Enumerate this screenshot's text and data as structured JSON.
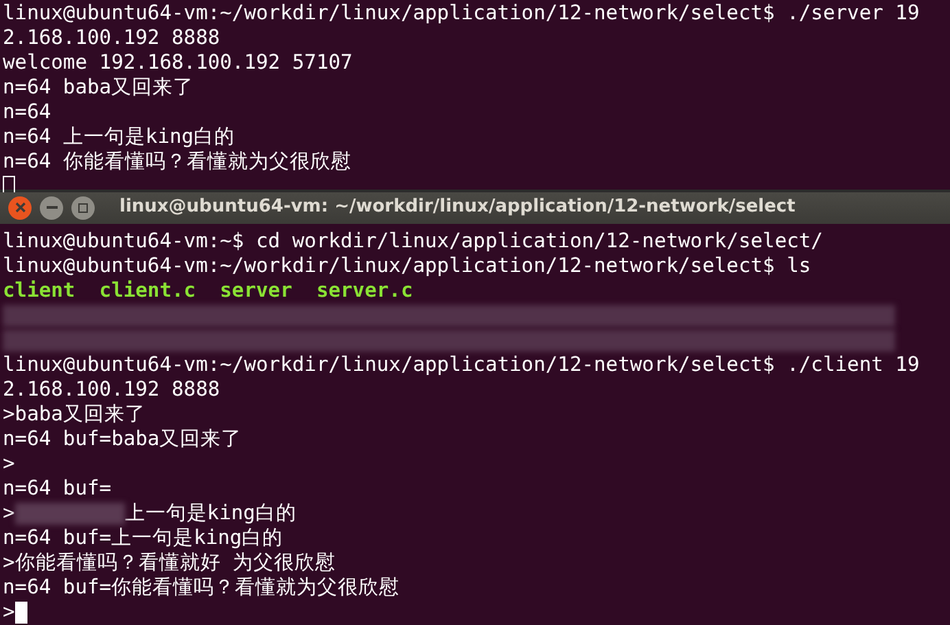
{
  "back_terminal": {
    "cursor_filled": false,
    "lines": [
      {
        "kind": "text",
        "text": "linux@ubuntu64-vm:~/workdir/linux/application/12-network/select$ ./server 19"
      },
      {
        "kind": "text",
        "text": "2.168.100.192 8888"
      },
      {
        "kind": "text",
        "text": "welcome 192.168.100.192 57107"
      },
      {
        "kind": "text",
        "text": "n=64 baba又回来了"
      },
      {
        "kind": "text",
        "text": "n=64"
      },
      {
        "kind": "text",
        "text": "n=64 上一句是king白的"
      },
      {
        "kind": "text",
        "text": "n=64 你能看懂吗？看懂就为父很欣慰"
      }
    ]
  },
  "front_terminal": {
    "title": "linux@ubuntu64-vm: ~/workdir/linux/application/12-network/select",
    "cursor_filled": true,
    "cursor_prefix": ">",
    "lines": [
      {
        "kind": "text",
        "text": "linux@ubuntu64-vm:~$ cd workdir/linux/application/12-network/select/"
      },
      {
        "kind": "text",
        "text": "linux@ubuntu64-vm:~/workdir/linux/application/12-network/select$ ls"
      },
      {
        "kind": "files",
        "text": "client  client.c  server  server.c"
      },
      {
        "kind": "blurred"
      },
      {
        "kind": "blurred"
      },
      {
        "kind": "text",
        "text": "linux@ubuntu64-vm:~/workdir/linux/application/12-network/select$ ./client 19"
      },
      {
        "kind": "text",
        "text": "2.168.100.192 8888"
      },
      {
        "kind": "text",
        "text": ">baba又回来了"
      },
      {
        "kind": "text",
        "text": "n=64 buf=baba又回来了"
      },
      {
        "kind": "text",
        "text": ">"
      },
      {
        "kind": "text",
        "text": "n=64 buf="
      },
      {
        "kind": "partly-blurred",
        "prefix": ">",
        "text": "上一句是king白的"
      },
      {
        "kind": "text",
        "text": "n=64 buf=上一句是king白的"
      },
      {
        "kind": "text",
        "text": ">你能看懂吗？看懂就好 为父很欣慰"
      },
      {
        "kind": "text",
        "text": "n=64 buf=你能看懂吗？看懂就为父很欣慰"
      }
    ]
  }
}
